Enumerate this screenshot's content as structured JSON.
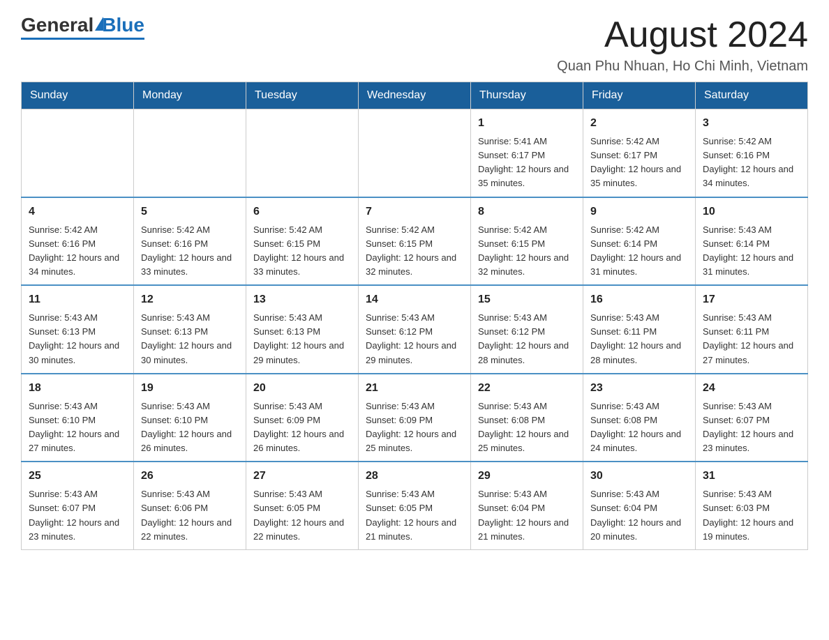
{
  "header": {
    "logo_general": "General",
    "logo_blue": "Blue",
    "month_year": "August 2024",
    "location": "Quan Phu Nhuan, Ho Chi Minh, Vietnam"
  },
  "weekdays": [
    "Sunday",
    "Monday",
    "Tuesday",
    "Wednesday",
    "Thursday",
    "Friday",
    "Saturday"
  ],
  "weeks": [
    [
      {
        "day": "",
        "info": ""
      },
      {
        "day": "",
        "info": ""
      },
      {
        "day": "",
        "info": ""
      },
      {
        "day": "",
        "info": ""
      },
      {
        "day": "1",
        "info": "Sunrise: 5:41 AM\nSunset: 6:17 PM\nDaylight: 12 hours and 35 minutes."
      },
      {
        "day": "2",
        "info": "Sunrise: 5:42 AM\nSunset: 6:17 PM\nDaylight: 12 hours and 35 minutes."
      },
      {
        "day": "3",
        "info": "Sunrise: 5:42 AM\nSunset: 6:16 PM\nDaylight: 12 hours and 34 minutes."
      }
    ],
    [
      {
        "day": "4",
        "info": "Sunrise: 5:42 AM\nSunset: 6:16 PM\nDaylight: 12 hours and 34 minutes."
      },
      {
        "day": "5",
        "info": "Sunrise: 5:42 AM\nSunset: 6:16 PM\nDaylight: 12 hours and 33 minutes."
      },
      {
        "day": "6",
        "info": "Sunrise: 5:42 AM\nSunset: 6:15 PM\nDaylight: 12 hours and 33 minutes."
      },
      {
        "day": "7",
        "info": "Sunrise: 5:42 AM\nSunset: 6:15 PM\nDaylight: 12 hours and 32 minutes."
      },
      {
        "day": "8",
        "info": "Sunrise: 5:42 AM\nSunset: 6:15 PM\nDaylight: 12 hours and 32 minutes."
      },
      {
        "day": "9",
        "info": "Sunrise: 5:42 AM\nSunset: 6:14 PM\nDaylight: 12 hours and 31 minutes."
      },
      {
        "day": "10",
        "info": "Sunrise: 5:43 AM\nSunset: 6:14 PM\nDaylight: 12 hours and 31 minutes."
      }
    ],
    [
      {
        "day": "11",
        "info": "Sunrise: 5:43 AM\nSunset: 6:13 PM\nDaylight: 12 hours and 30 minutes."
      },
      {
        "day": "12",
        "info": "Sunrise: 5:43 AM\nSunset: 6:13 PM\nDaylight: 12 hours and 30 minutes."
      },
      {
        "day": "13",
        "info": "Sunrise: 5:43 AM\nSunset: 6:13 PM\nDaylight: 12 hours and 29 minutes."
      },
      {
        "day": "14",
        "info": "Sunrise: 5:43 AM\nSunset: 6:12 PM\nDaylight: 12 hours and 29 minutes."
      },
      {
        "day": "15",
        "info": "Sunrise: 5:43 AM\nSunset: 6:12 PM\nDaylight: 12 hours and 28 minutes."
      },
      {
        "day": "16",
        "info": "Sunrise: 5:43 AM\nSunset: 6:11 PM\nDaylight: 12 hours and 28 minutes."
      },
      {
        "day": "17",
        "info": "Sunrise: 5:43 AM\nSunset: 6:11 PM\nDaylight: 12 hours and 27 minutes."
      }
    ],
    [
      {
        "day": "18",
        "info": "Sunrise: 5:43 AM\nSunset: 6:10 PM\nDaylight: 12 hours and 27 minutes."
      },
      {
        "day": "19",
        "info": "Sunrise: 5:43 AM\nSunset: 6:10 PM\nDaylight: 12 hours and 26 minutes."
      },
      {
        "day": "20",
        "info": "Sunrise: 5:43 AM\nSunset: 6:09 PM\nDaylight: 12 hours and 26 minutes."
      },
      {
        "day": "21",
        "info": "Sunrise: 5:43 AM\nSunset: 6:09 PM\nDaylight: 12 hours and 25 minutes."
      },
      {
        "day": "22",
        "info": "Sunrise: 5:43 AM\nSunset: 6:08 PM\nDaylight: 12 hours and 25 minutes."
      },
      {
        "day": "23",
        "info": "Sunrise: 5:43 AM\nSunset: 6:08 PM\nDaylight: 12 hours and 24 minutes."
      },
      {
        "day": "24",
        "info": "Sunrise: 5:43 AM\nSunset: 6:07 PM\nDaylight: 12 hours and 23 minutes."
      }
    ],
    [
      {
        "day": "25",
        "info": "Sunrise: 5:43 AM\nSunset: 6:07 PM\nDaylight: 12 hours and 23 minutes."
      },
      {
        "day": "26",
        "info": "Sunrise: 5:43 AM\nSunset: 6:06 PM\nDaylight: 12 hours and 22 minutes."
      },
      {
        "day": "27",
        "info": "Sunrise: 5:43 AM\nSunset: 6:05 PM\nDaylight: 12 hours and 22 minutes."
      },
      {
        "day": "28",
        "info": "Sunrise: 5:43 AM\nSunset: 6:05 PM\nDaylight: 12 hours and 21 minutes."
      },
      {
        "day": "29",
        "info": "Sunrise: 5:43 AM\nSunset: 6:04 PM\nDaylight: 12 hours and 21 minutes."
      },
      {
        "day": "30",
        "info": "Sunrise: 5:43 AM\nSunset: 6:04 PM\nDaylight: 12 hours and 20 minutes."
      },
      {
        "day": "31",
        "info": "Sunrise: 5:43 AM\nSunset: 6:03 PM\nDaylight: 12 hours and 19 minutes."
      }
    ]
  ]
}
